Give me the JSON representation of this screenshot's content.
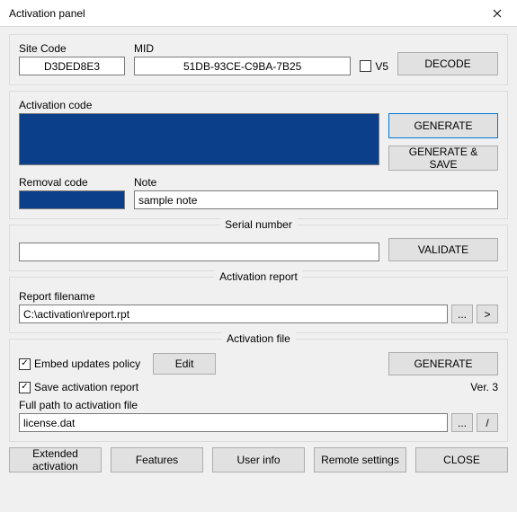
{
  "window": {
    "title": "Activation panel"
  },
  "top": {
    "site_code_label": "Site Code",
    "site_code_value": "D3DED8E3",
    "mid_label": "MID",
    "mid_value": "51DB-93CE-C9BA-7B25",
    "v5_label": "V5",
    "decode_button": "DECODE"
  },
  "activation": {
    "code_label": "Activation code",
    "code_value": "",
    "generate_button": "GENERATE",
    "generate_save_button": "GENERATE & SAVE",
    "removal_label": "Removal code",
    "removal_value": "",
    "note_label": "Note",
    "note_value": "sample note"
  },
  "serial": {
    "legend": "Serial number",
    "value": "",
    "validate_button": "VALIDATE"
  },
  "report": {
    "legend": "Activation report",
    "filename_label": "Report filename",
    "filename_value": "C:\\activation\\report.rpt",
    "browse_button": "...",
    "go_button": ">"
  },
  "file": {
    "legend": "Activation file",
    "embed_label": "Embed updates policy",
    "edit_button": "Edit",
    "generate_button": "GENERATE",
    "save_report_label": "Save activation report",
    "version_label": "Ver. 3",
    "path_label": "Full path to activation file",
    "path_value": "license.dat",
    "browse_button": "...",
    "go_button": "/"
  },
  "bottom": {
    "extended": "Extended activation",
    "features": "Features",
    "user_info": "User info",
    "remote": "Remote settings",
    "close": "CLOSE"
  }
}
